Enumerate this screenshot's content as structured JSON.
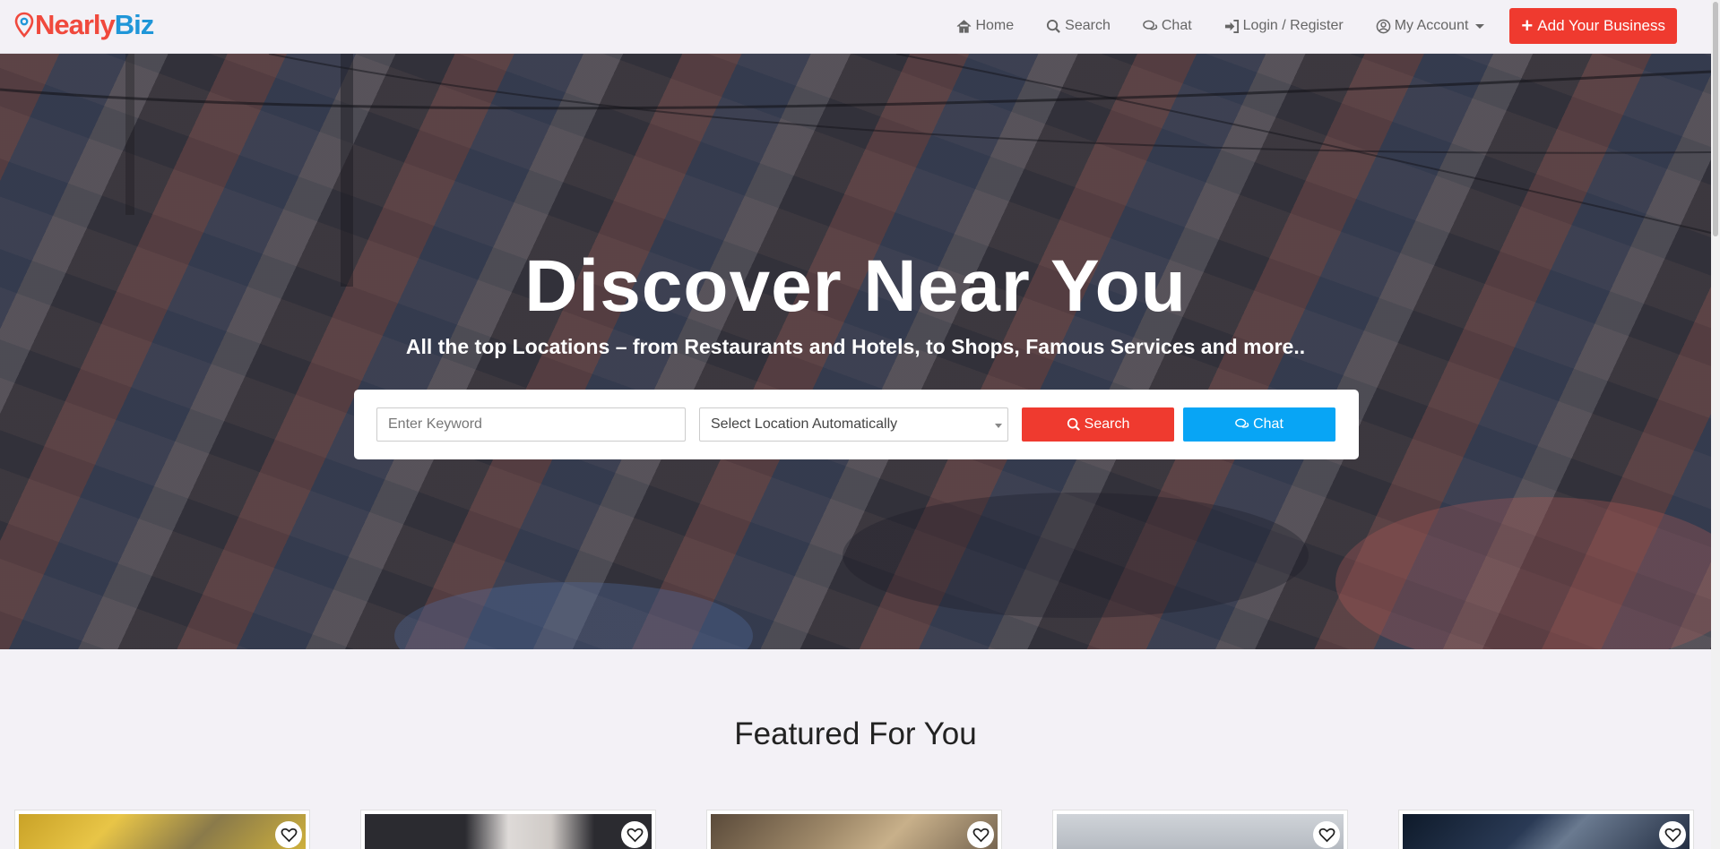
{
  "brand": {
    "part1": "Nearly",
    "part2": "Biz"
  },
  "nav": {
    "home": "Home",
    "search": "Search",
    "chat": "Chat",
    "login": "Login / Register",
    "account": "My Account",
    "add_business": "Add Your Business"
  },
  "hero": {
    "title": "Discover Near You",
    "subtitle": "All the top Locations – from Restaurants and Hotels, to Shops, Famous Services and more..",
    "keyword_placeholder": "Enter Keyword",
    "location_value": "Select Location Automatically",
    "search_label": "Search",
    "chat_label": "Chat"
  },
  "featured": {
    "title": "Featured For You",
    "cards": [
      {
        "image": "yellow-leaves-photo"
      },
      {
        "image": "portrait-photo"
      },
      {
        "image": "food-photo"
      },
      {
        "image": "snowy-landscape-photo"
      },
      {
        "image": "dark-creature-photo"
      }
    ]
  },
  "colors": {
    "accent_red": "#ef3a2f",
    "accent_blue": "#08a5f5",
    "logo_red": "#f0493d",
    "logo_blue": "#1f96d8"
  }
}
